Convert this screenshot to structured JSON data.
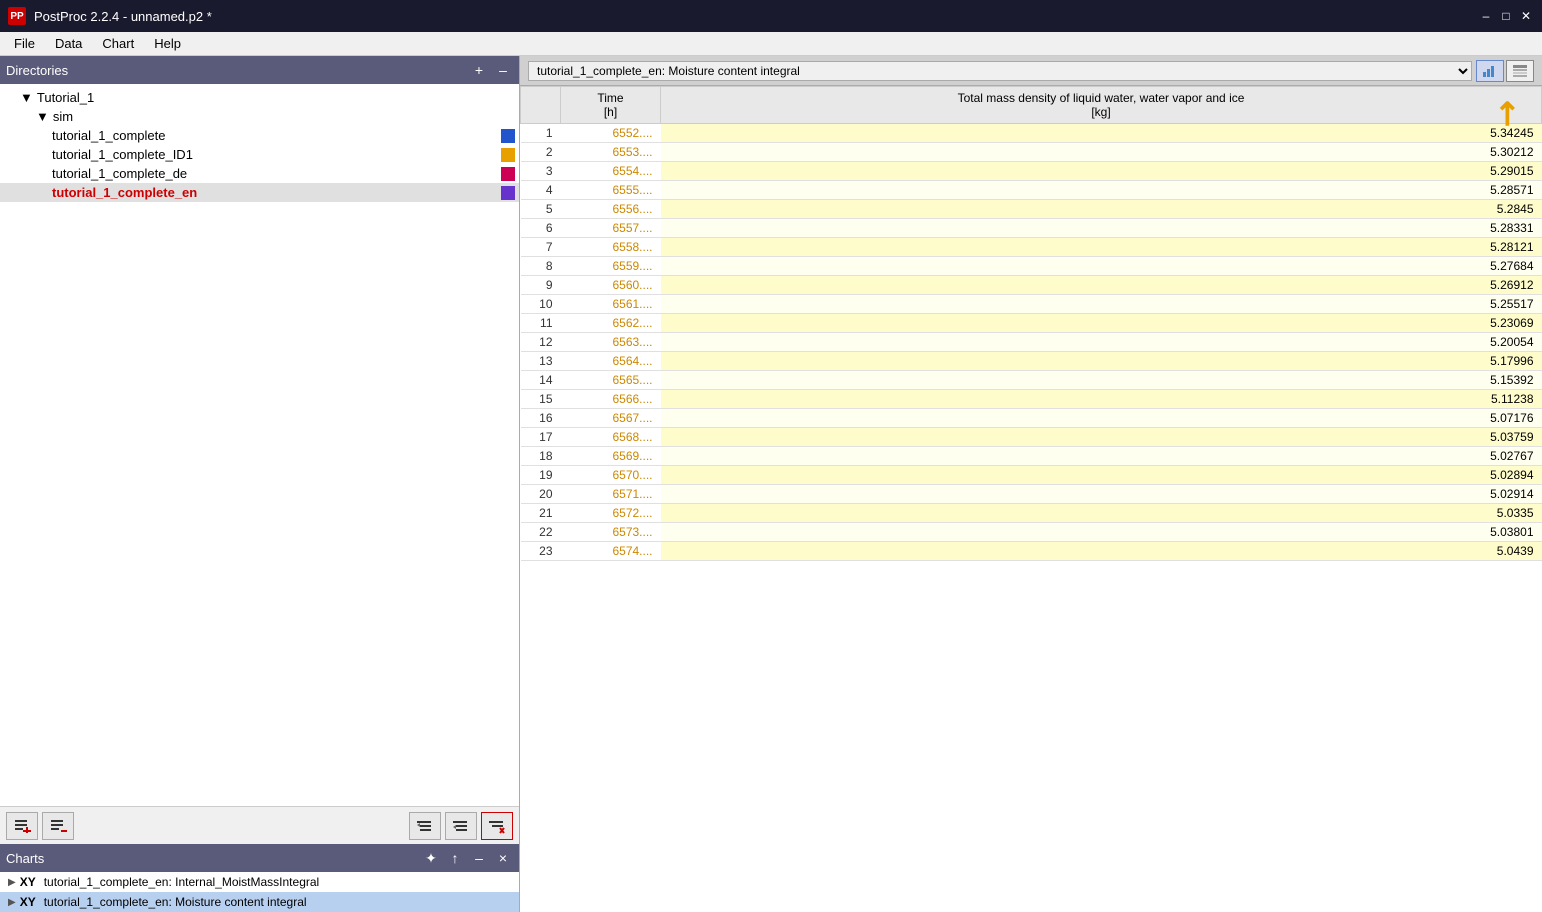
{
  "titleBar": {
    "title": "PostProc 2.2.4 - unnamed.p2 *",
    "appIconLabel": "PP"
  },
  "menuBar": {
    "items": [
      "File",
      "Data",
      "Chart",
      "Help"
    ]
  },
  "directories": {
    "header": "Directories",
    "addBtn": "+",
    "collapseBtn": "–",
    "tree": [
      {
        "label": "Tutorial_1",
        "indent": 1,
        "icon": "▼",
        "color": null
      },
      {
        "label": "sim",
        "indent": 2,
        "icon": "▼",
        "color": null
      },
      {
        "label": "tutorial_1_complete",
        "indent": 3,
        "icon": null,
        "color": "#2255cc"
      },
      {
        "label": "tutorial_1_complete_ID1",
        "indent": 3,
        "icon": null,
        "color": "#e8a000"
      },
      {
        "label": "tutorial_1_complete_de",
        "indent": 3,
        "icon": null,
        "color": "#cc0055"
      },
      {
        "label": "tutorial_1_complete_en",
        "indent": 3,
        "icon": null,
        "color": "#6633cc",
        "active": true
      }
    ],
    "buttons": {
      "addList": "☰+",
      "removeList": "☰-",
      "addItem": "□+",
      "removeItem": "□-",
      "deleteRed": "✕"
    }
  },
  "charts": {
    "header": "Charts",
    "addBtn": "✦",
    "upBtn": "↑",
    "collapseBtn": "–",
    "closeBtn": "×",
    "items": [
      {
        "prefix": "XY",
        "label": "tutorial_1_complete_en: Internal_MoistMassIntegral"
      },
      {
        "prefix": "XY",
        "label": "tutorial_1_complete_en: Moisture content integral",
        "selected": true
      }
    ]
  },
  "tablePanel": {
    "title": "tutorial_1_complete_en: Moisture content integral",
    "colHeaders": [
      "",
      "Time\n[h]",
      "Total mass density of liquid water, water vapor and ice\n[kg]"
    ],
    "col1Header": "Time\n[h]",
    "col2Header": "Total mass density of liquid water, water vapor and ice\n[kg]",
    "rows": [
      {
        "num": 1,
        "time": "6552....",
        "value": "5.34245"
      },
      {
        "num": 2,
        "time": "6553....",
        "value": "5.30212"
      },
      {
        "num": 3,
        "time": "6554....",
        "value": "5.29015"
      },
      {
        "num": 4,
        "time": "6555....",
        "value": "5.28571"
      },
      {
        "num": 5,
        "time": "6556....",
        "value": "5.2845"
      },
      {
        "num": 6,
        "time": "6557....",
        "value": "5.28331"
      },
      {
        "num": 7,
        "time": "6558....",
        "value": "5.28121"
      },
      {
        "num": 8,
        "time": "6559....",
        "value": "5.27684"
      },
      {
        "num": 9,
        "time": "6560....",
        "value": "5.26912"
      },
      {
        "num": 10,
        "time": "6561....",
        "value": "5.25517"
      },
      {
        "num": 11,
        "time": "6562....",
        "value": "5.23069"
      },
      {
        "num": 12,
        "time": "6563....",
        "value": "5.20054"
      },
      {
        "num": 13,
        "time": "6564....",
        "value": "5.17996"
      },
      {
        "num": 14,
        "time": "6565....",
        "value": "5.15392"
      },
      {
        "num": 15,
        "time": "6566....",
        "value": "5.11238"
      },
      {
        "num": 16,
        "time": "6567....",
        "value": "5.07176"
      },
      {
        "num": 17,
        "time": "6568....",
        "value": "5.03759"
      },
      {
        "num": 18,
        "time": "6569....",
        "value": "5.02767"
      },
      {
        "num": 19,
        "time": "6570....",
        "value": "5.02894"
      },
      {
        "num": 20,
        "time": "6571....",
        "value": "5.02914"
      },
      {
        "num": 21,
        "time": "6572....",
        "value": "5.0335"
      },
      {
        "num": 22,
        "time": "6573....",
        "value": "5.03801"
      },
      {
        "num": 23,
        "time": "6574....",
        "value": "5.0439"
      }
    ]
  },
  "colors": {
    "blue": "#2255cc",
    "orange": "#e8a000",
    "red": "#cc0055",
    "purple": "#6633cc",
    "headerBg": "#5a5a7a",
    "activeRed": "#cc0000"
  }
}
